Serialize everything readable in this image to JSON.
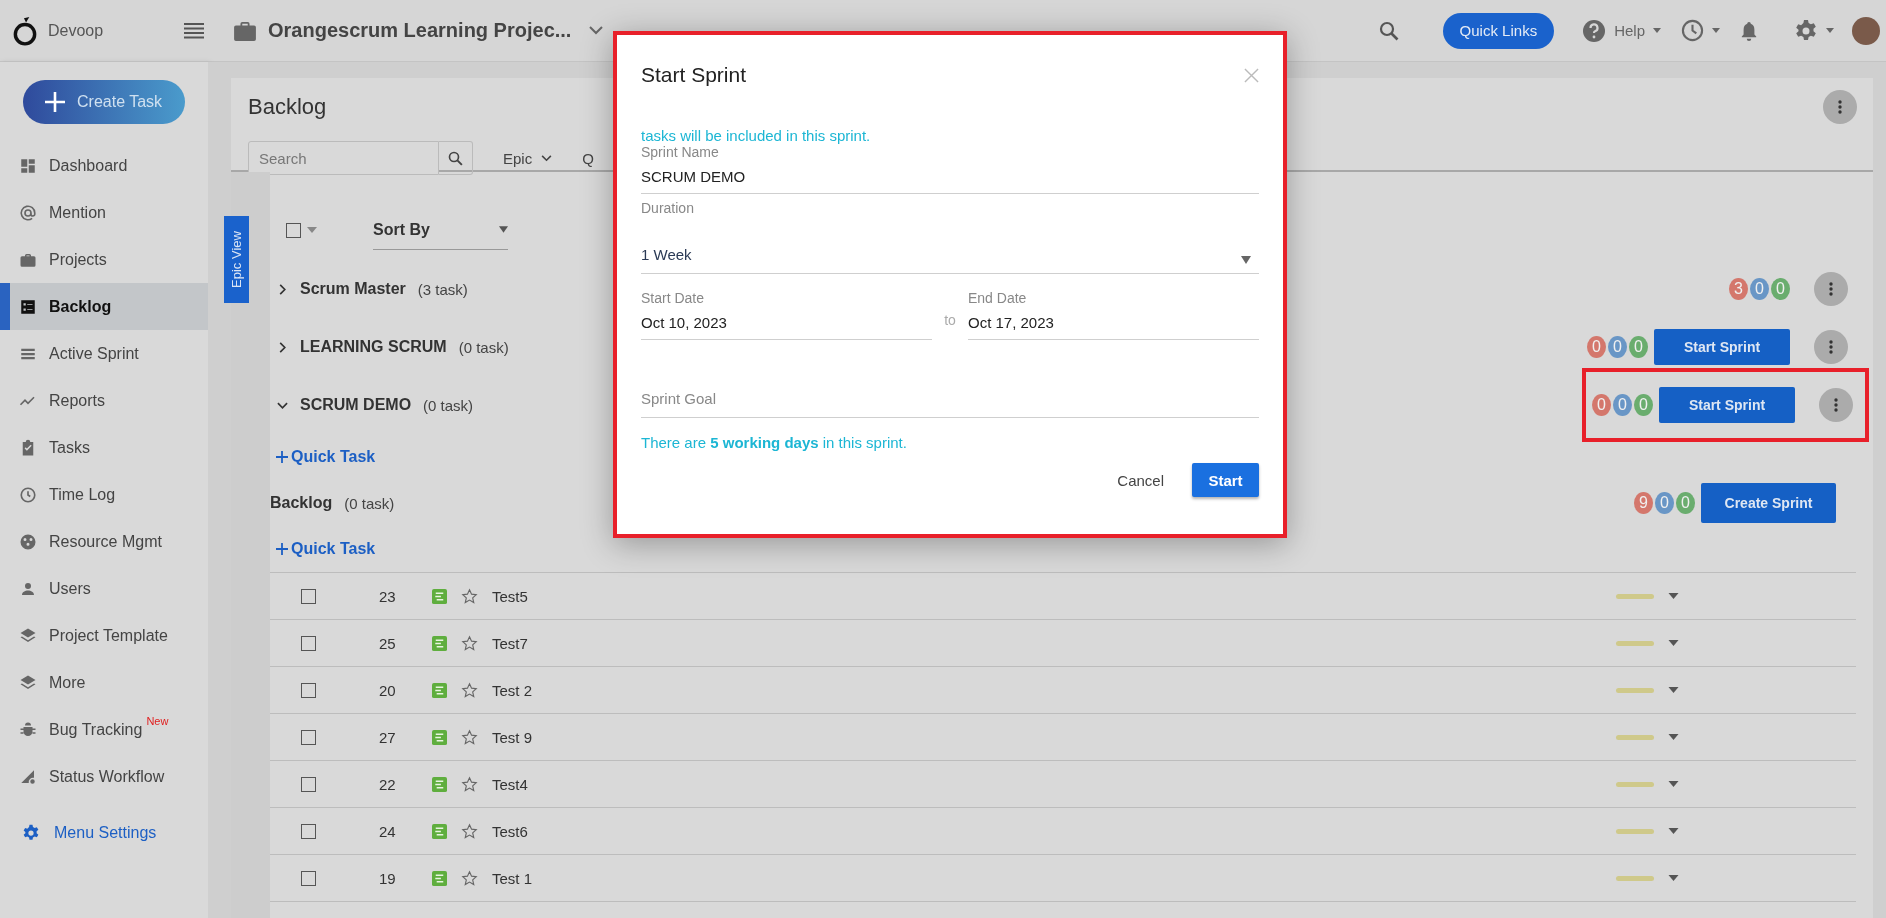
{
  "topbar": {
    "brand": "Devoop",
    "project": "Orangescrum Learning Projec...",
    "quick_links": "Quick Links",
    "help": "Help"
  },
  "sidebar": {
    "create_task": "Create Task",
    "items": [
      {
        "label": "Dashboard",
        "selected": false
      },
      {
        "label": "Mention",
        "selected": false
      },
      {
        "label": "Projects",
        "selected": false
      },
      {
        "label": "Backlog",
        "selected": true
      },
      {
        "label": "Active Sprint",
        "selected": false
      },
      {
        "label": "Reports",
        "selected": false
      },
      {
        "label": "Tasks",
        "selected": false
      },
      {
        "label": "Time Log",
        "selected": false
      },
      {
        "label": "Resource Mgmt",
        "selected": false
      },
      {
        "label": "Users",
        "selected": false
      },
      {
        "label": "Project Template",
        "selected": false
      },
      {
        "label": "More",
        "selected": false
      },
      {
        "label": "Bug Tracking",
        "selected": false,
        "badge": "New"
      },
      {
        "label": "Status Workflow",
        "selected": false
      }
    ],
    "menu_settings": "Menu Settings"
  },
  "backlog": {
    "title": "Backlog",
    "search": {
      "placeholder": "Search"
    },
    "filters": [
      {
        "label": "Epic",
        "dropdown": true
      },
      {
        "label": "Q",
        "dropdown": false
      }
    ],
    "epic_view": "Epic View",
    "select_all": {
      "checked": false
    },
    "sort_by": "Sort By",
    "sprints": [
      {
        "name": "Scrum Master",
        "count": "(3 task)",
        "expanded": false,
        "highlighted": false,
        "counts": [
          {
            "value": "3",
            "color": "#d4776c"
          },
          {
            "value": "0",
            "color": "#6996c6"
          },
          {
            "value": "0",
            "color": "#6aad6e"
          }
        ],
        "menu": true
      },
      {
        "name": "LEARNING SCRUM",
        "count": "(0 task)",
        "expanded": false,
        "highlighted": false,
        "counts": [
          {
            "value": "0",
            "color": "#d4776c"
          },
          {
            "value": "0",
            "color": "#6996c6"
          },
          {
            "value": "0",
            "color": "#6aad6e"
          }
        ],
        "action": "Start Sprint",
        "menu": true
      },
      {
        "name": "SCRUM DEMO",
        "count": "(0 task)",
        "expanded": true,
        "highlighted": true,
        "quick_task": "Quick Task",
        "counts": [
          {
            "value": "0",
            "color": "#d4776c"
          },
          {
            "value": "0",
            "color": "#6996c6"
          },
          {
            "value": "0",
            "color": "#6aad6e"
          }
        ],
        "action": "Start Sprint",
        "menu": true
      }
    ],
    "backlog_section": {
      "name": "Backlog",
      "count": "(0 task)",
      "counts": [
        {
          "value": "9",
          "color": "#d4776c"
        },
        {
          "value": "0",
          "color": "#6996c6"
        },
        {
          "value": "0",
          "color": "#6aad6e"
        }
      ],
      "action": "Create Sprint",
      "quick_task": "Quick Task"
    },
    "tasks": [
      {
        "id": "23",
        "title": "Test5",
        "checked": false
      },
      {
        "id": "25",
        "title": "Test7",
        "checked": false
      },
      {
        "id": "20",
        "title": "Test 2",
        "checked": false
      },
      {
        "id": "27",
        "title": "Test 9",
        "checked": false
      },
      {
        "id": "22",
        "title": "Test4",
        "checked": false
      },
      {
        "id": "24",
        "title": "Test6",
        "checked": false
      },
      {
        "id": "19",
        "title": "Test 1",
        "checked": false
      }
    ]
  },
  "modal": {
    "title": "Start Sprint",
    "highlighted": true,
    "info": "tasks will be included in this sprint.",
    "sprint_name": {
      "label": "Sprint Name",
      "value": "SCRUM DEMO"
    },
    "duration": {
      "label": "Duration",
      "value": "1 Week"
    },
    "start_date": {
      "label": "Start Date",
      "value": "Oct 10, 2023"
    },
    "separator": "to",
    "end_date": {
      "label": "End Date",
      "value": "Oct 17, 2023"
    },
    "sprint_goal": {
      "placeholder": "Sprint Goal"
    },
    "working_days": "There are **5 working days** in this sprint.",
    "cancel": "Cancel",
    "start": "Start"
  }
}
